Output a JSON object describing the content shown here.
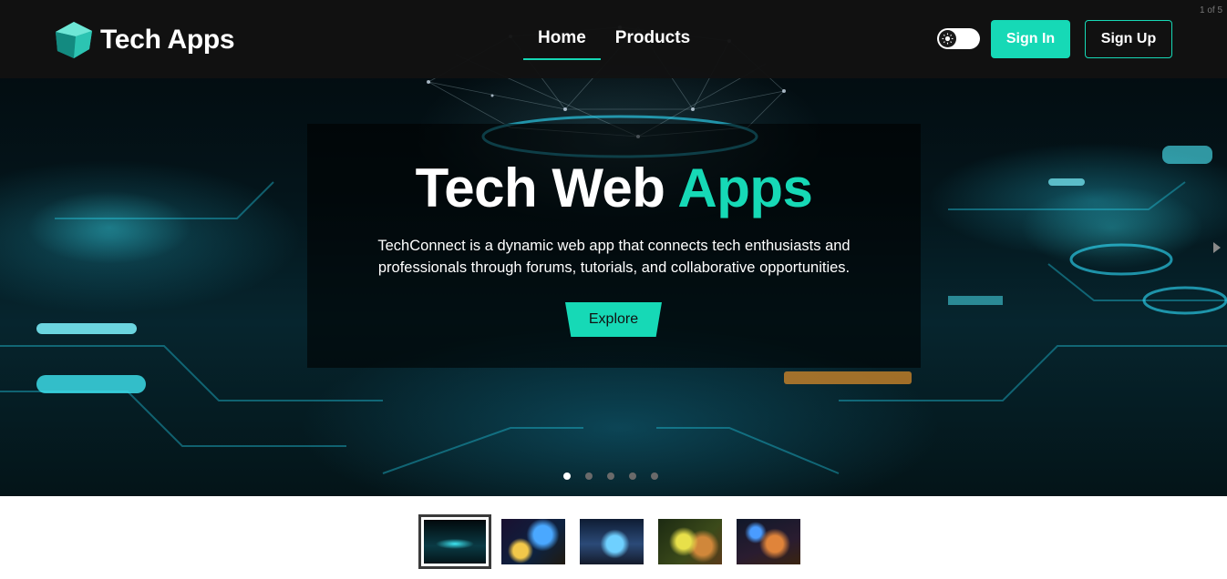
{
  "header": {
    "brand_name": "Tech Apps",
    "logo_icon": "cube-logo-icon",
    "nav": [
      {
        "label": "Home",
        "active": true
      },
      {
        "label": "Products",
        "active": false
      }
    ],
    "theme_toggle_icon": "sun-icon",
    "sign_in_label": "Sign In",
    "sign_up_label": "Sign Up"
  },
  "carousel": {
    "counter": "1 of 5",
    "title_main": "Tech Web ",
    "title_accent": "Apps",
    "description": "TechConnect is a dynamic web app that connects tech enthusiasts and professionals through forums, tutorials, and collaborative opportunities.",
    "cta_label": "Explore",
    "next_icon": "chevron-right-icon",
    "slide_count": 5,
    "active_slide": 1
  },
  "colors": {
    "accent": "#16d9b6",
    "navbar_bg": "#121212",
    "text": "#ffffff"
  }
}
